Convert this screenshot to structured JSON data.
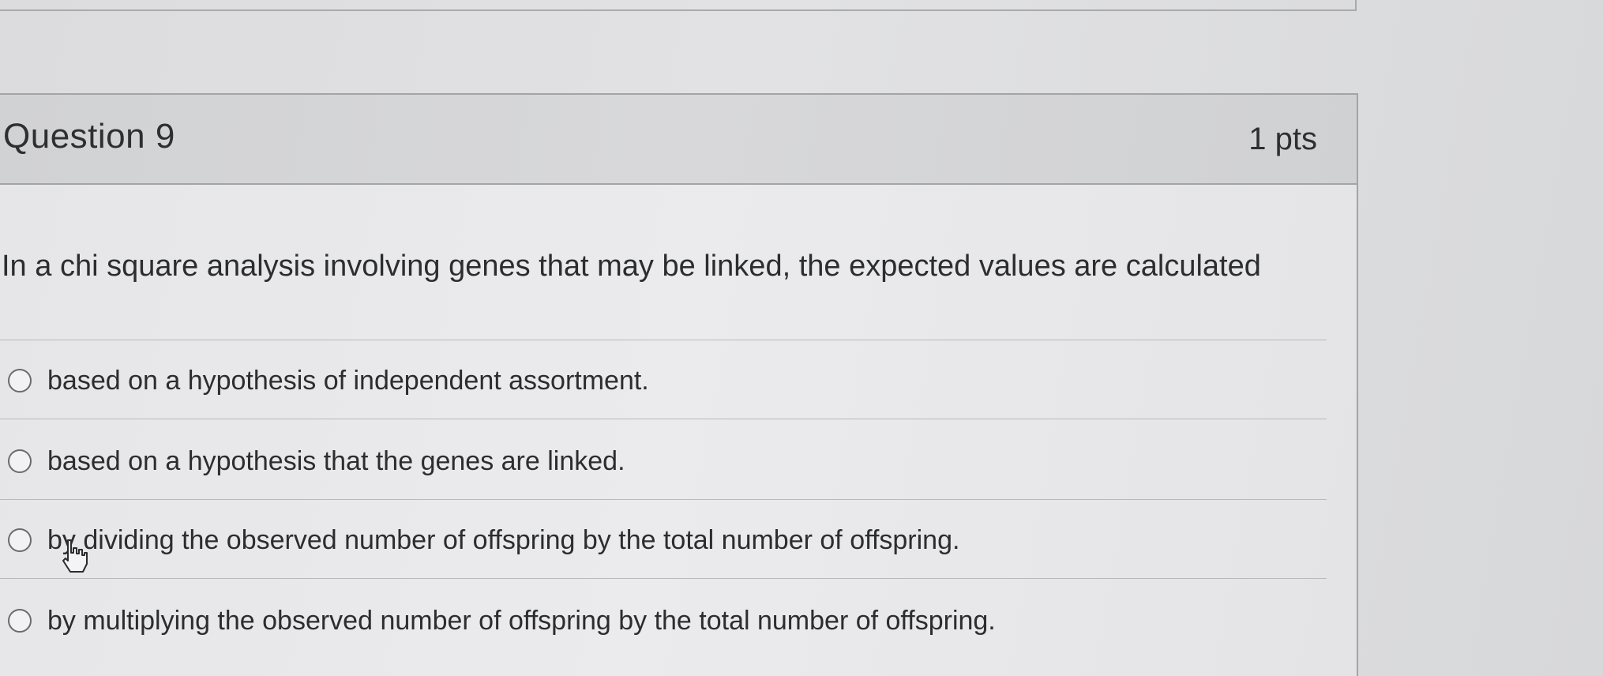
{
  "question": {
    "title": "Question 9",
    "points": "1 pts",
    "prompt": "In a chi square analysis involving genes that may be linked, the expected values are calculated",
    "answers": [
      {
        "label": "based on a hypothesis of independent assortment.",
        "selected": false
      },
      {
        "label": "based on a hypothesis that the genes are linked.",
        "selected": false
      },
      {
        "label": "by dividing the observed number of offspring by the total number of offspring.",
        "selected": false
      },
      {
        "label": "by multiplying the observed number of offspring by the total number of offspring.",
        "selected": false
      }
    ]
  },
  "icons": {
    "radio": "radio-circle-icon",
    "cursor": "hand-pointer-icon"
  },
  "colors": {
    "header_bg": "#d4d5d7",
    "body_bg": "#e8e8ea",
    "text": "#2c2d2f",
    "border": "#a3a4a6"
  }
}
